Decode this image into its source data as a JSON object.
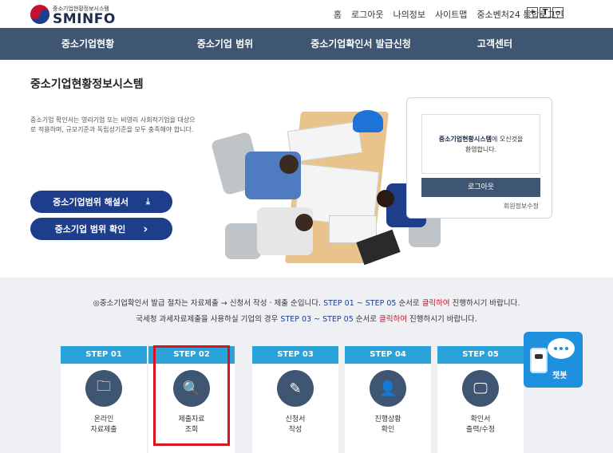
{
  "header": {
    "logo_sub": "중소기업현황정보시스템",
    "logo_main": "SMINFO",
    "util_links": [
      "홈",
      "로그아웃",
      "나의정보",
      "사이트맵",
      "중소벤처24 통합로그인"
    ],
    "font_controls": [
      "+",
      "T",
      "−"
    ]
  },
  "gnb": {
    "items": [
      "중소기업현황",
      "중소기업 범위",
      "중소기업확인서 발급신청",
      "고객센터"
    ]
  },
  "hero": {
    "title": "중소기업현황정보시스템",
    "description": "중소기업 확인서는 영리기업 또는 비영리 사회적기업을 대상으로 적용하며, 규모기준과 독립성기준을 모두 충족해야 합니다.",
    "buttons": [
      {
        "label": "중소기업범위 해설서",
        "icon": "download-icon",
        "glyph": "⤓"
      },
      {
        "label": "중소기업 범위 확인",
        "icon": "chevron-right-icon",
        "glyph": "›"
      }
    ]
  },
  "login": {
    "welcome_bold": "중소기업현황시스템",
    "welcome_rest1": "에 오신것을",
    "welcome_rest2": "환영합니다.",
    "logout_label": "로그아웃",
    "edit_label": "회원정보수정"
  },
  "notice": {
    "line1_a": "◎중소기업확인서 발급 절차는 자료제출 → 신청서 작성 · 제출 순입니다. ",
    "line1_b": "STEP 01 ~ STEP 05",
    "line1_c": " 순서로 ",
    "line1_d": "클릭하여",
    "line1_e": " 진행하시기 바랍니다.",
    "line2_a": "국세청 과세자료제출을 사용하실 기업의 경우 ",
    "line2_b": "STEP 03 ~ STEP 05",
    "line2_c": " 순서로 ",
    "line2_d": "클릭하여",
    "line2_e": " 진행하시기 바랍니다."
  },
  "steps": [
    {
      "head": "STEP 01",
      "line1": "온라인",
      "line2": "자료제출",
      "icon": "folder-icon",
      "glyph": "🗀"
    },
    {
      "head": "STEP 02",
      "line1": "제출자료",
      "line2": "조회",
      "icon": "document-search-icon",
      "glyph": "🔍"
    },
    {
      "head": "STEP 03",
      "line1": "신청서",
      "line2": "작성",
      "icon": "document-edit-icon",
      "glyph": "✎"
    },
    {
      "head": "STEP 04",
      "line1": "진행상황",
      "line2": "확인",
      "icon": "person-document-icon",
      "glyph": "👤"
    },
    {
      "head": "STEP 05",
      "line1": "확인서",
      "line2": "출력/수정",
      "icon": "monitor-icon",
      "glyph": "🖵"
    }
  ],
  "chatbot": {
    "label": "챗봇",
    "icon": "chatbot-icon"
  },
  "colors": {
    "nav": "#3e5672",
    "accent": "#1e3e8c",
    "step": "#29a3d9",
    "highlight": "#d9141e",
    "chatbot": "#1e90dd"
  }
}
